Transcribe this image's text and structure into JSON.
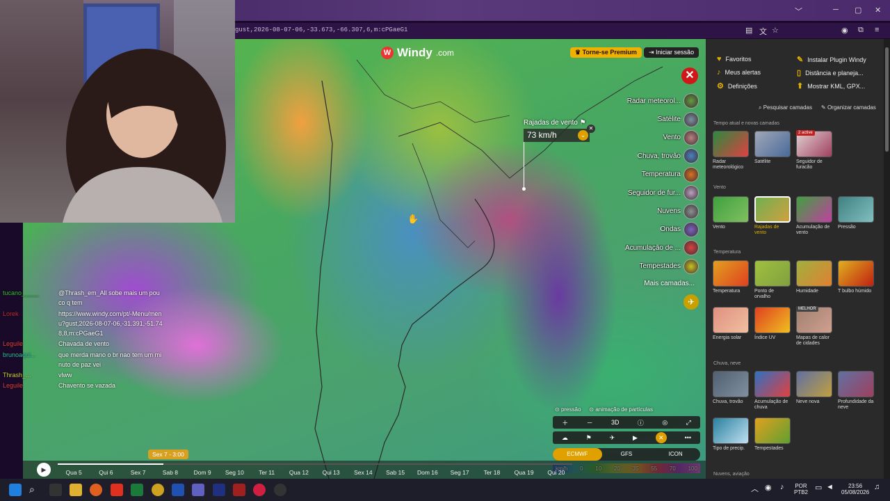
{
  "browser": {
    "url": "gust,2026-08-07-06,-33.673,-66.307,6,m:cPGaeG1"
  },
  "header": {
    "brand": "Windy",
    "brand_suffix": ".com",
    "premium": "Torne-se Premium",
    "login": "Iniciar sessão"
  },
  "layers": [
    "Radar meteorol...",
    "Satélite",
    "Vento",
    "Chuva, trovão",
    "Temperatura",
    "Seguidor de fur...",
    "Nuvens",
    "Ondas",
    "Acumulação de ...",
    "Tempestades"
  ],
  "layer_colors": [
    "#6a9a40",
    "#8090a0",
    "#c08080",
    "#5080c0",
    "#e07020",
    "#c0a0c0",
    "#909090",
    "#8060c0",
    "#e04040",
    "#d0c020"
  ],
  "more_layers": "Mais camadas...",
  "picker": {
    "label": "Rajadas de vento",
    "value": "73 km/h"
  },
  "map_controls": {
    "pressure": "pressão",
    "particles": "animação de partículas",
    "three_d": "3D",
    "models": [
      "ECMWF",
      "GFS",
      "ICON"
    ],
    "legend_unit": "km/h",
    "legend_values": [
      "0",
      "10",
      "20",
      "35",
      "55",
      "70",
      "100"
    ]
  },
  "timeline": {
    "current": "Sex 7 - 3:00",
    "progress": 0.205,
    "days": [
      "Qua 5",
      "Qui 6",
      "Sex 7",
      "Sab 8",
      "Dom 9",
      "Seg 10",
      "Ter 11",
      "Qua 12",
      "Qui 13",
      "Sex 14",
      "Sab 15",
      "Dom 16",
      "Seg 17",
      "Ter 18",
      "Qua 19",
      "Qui 20"
    ]
  },
  "panel": {
    "links": [
      "Favoritos",
      "Meus alertas",
      "Definições",
      "Instalar Plugin Windy",
      "Distância e planeja...",
      "Mostrar KML, GPX..."
    ],
    "search": "Pesquisar camadas",
    "organize": "Organizar camadas",
    "sections": {
      "s1": "Tempo atual e novas camadas",
      "s2": "Vento",
      "s3": "Temperatura",
      "s4": "Chuva, neve",
      "s5": "Nuvens, aviação"
    },
    "tiles": {
      "t1": "Radar meteorológico",
      "t2": "Satélite",
      "t3": "Seguidor de furacão",
      "t3badge": "2 active",
      "t4": "Vento",
      "t5": "Rajadas de vento",
      "t6": "Acumulação de vento",
      "t7": "Pressão",
      "t8": "Temperatura",
      "t9": "Ponto de orvalho",
      "t10": "Humidade",
      "t11": "T bulbo húmido",
      "t12": "Energia solar",
      "t13": "Índice UV",
      "t14": "Mapas de calor de cidades",
      "t14badge": "MELHOR",
      "t15": "Chuva, trovão",
      "t16": "Acumulação de chuva",
      "t17": "Neve nova",
      "t18": "Profundidade da neve",
      "t19": "Tipo de precip.",
      "t20": "Tempestades"
    }
  },
  "chat": [
    {
      "user": "tucano_____",
      "msg": "@Thrash_em_All sobe mais um pouco q tem",
      "color": "#30c030"
    },
    {
      "user": "Lorek",
      "msg": "https://www.windy.com/pt/-Menu/menu?gust,2026-08-07-06,-31.391,-51.748,8,m:cPGaeG1",
      "color": "#c03030"
    },
    {
      "user": "Leguile",
      "msg": "Chavada de vento",
      "color": "#e04040"
    },
    {
      "user": "brunoaqui...",
      "msg": "que merda mano o br nao tem um minuto de paz vei",
      "color": "#30c0a0"
    },
    {
      "user": "Thrash_...",
      "msg": "vlww",
      "color": "#d0d030"
    },
    {
      "user": "Leguile",
      "msg": "Chavento se vazada",
      "color": "#e04040"
    }
  ],
  "tray": {
    "lang": "POR",
    "layout": "PTB2",
    "time": "23:56",
    "date": "05/08/2026"
  }
}
